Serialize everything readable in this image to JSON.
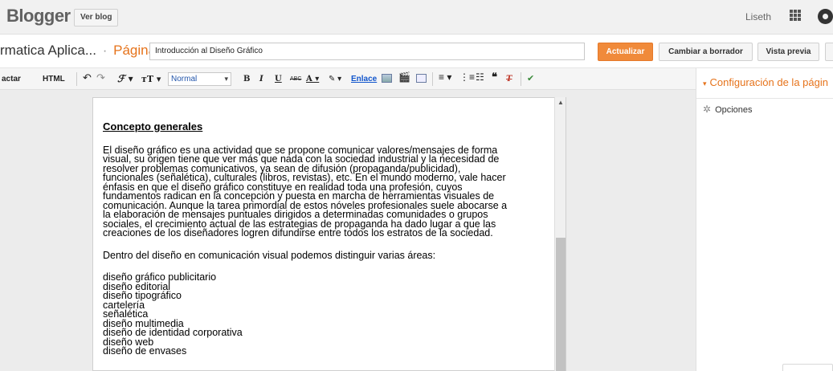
{
  "topbar": {
    "brand": "Blogger",
    "view_blog_label": "Ver blog",
    "user_name": "Liseth"
  },
  "titlebar": {
    "blog_name": "rmatica Aplica...",
    "separator": "·",
    "page_label": "Página",
    "title_value": "Introducción al Diseño Gráfico",
    "update_label": "Actualizar",
    "draft_label": "Cambiar a borrador",
    "preview_label": "Vista previa"
  },
  "toolbar": {
    "compose_label": "actar",
    "html_label": "HTML",
    "font_size_value": "Normal",
    "link_label": "Enlace"
  },
  "document": {
    "heading": "Concepto generales",
    "paragraph1_lines": [
      "El diseño gráfico es una actividad que se propone comunicar valores/mensajes de forma",
      "visual, su origen tiene que ver más que nada con la sociedad industrial y la necesidad de",
      "resolver problemas comunicativos, ya sean de difusión (propaganda/publicidad),",
      "funcionales (señalética), culturales (libros, revistas), etc. En el mundo moderno, vale hacer",
      "énfasis en que el diseño gráfico constituye en realidad toda una profesión, cuyos",
      "fundamentos radican en la concepción y puesta en marcha de herramientas visuales de",
      "comunicación. Aunque la tarea primordial de estos nóveles profesionales suele abocarse a",
      "la elaboración de mensajes puntuales dirigidos a determinadas comunidades o grupos",
      "sociales, el crecimiento actual de las estrategias de propaganda ha dado lugar a que las",
      "creaciones de los diseñadores logren difundirse entre todos los estratos de la sociedad."
    ],
    "paragraph2": "Dentro del diseño en comunicación visual podemos distinguir varias áreas:",
    "areas": [
      "diseño gráfico publicitario",
      "diseño editorial",
      "diseño tipográfico",
      "cartelería",
      "señalética",
      "diseño multimedia",
      "diseño de identidad corporativa",
      "diseño web",
      "diseño de envases"
    ]
  },
  "sidebar": {
    "section_title": "Configuración de la págin",
    "option_label": "Opciones"
  },
  "colors": {
    "accent": "#e6731b",
    "update_button": "#f08a3a",
    "link": "#1155cc"
  }
}
